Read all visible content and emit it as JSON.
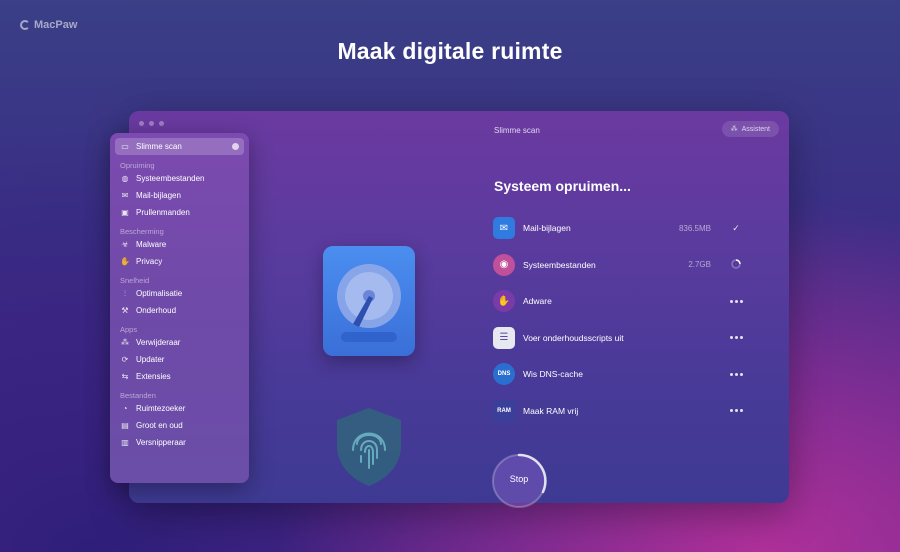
{
  "brand": {
    "name": "MacPaw"
  },
  "headline": "Maak digitale ruimte",
  "window": {
    "title": "Slimme scan",
    "assistant_label": "Assistent"
  },
  "sidebar": {
    "active": {
      "label": "Slimme scan",
      "icon": "monitor-icon"
    },
    "sections": [
      {
        "header": "Opruiming",
        "items": [
          {
            "label": "Systeembestanden",
            "icon": "fingerprint-icon"
          },
          {
            "label": "Mail-bijlagen",
            "icon": "mail-icon"
          },
          {
            "label": "Prullenmanden",
            "icon": "trash-icon"
          }
        ]
      },
      {
        "header": "Bescherming",
        "items": [
          {
            "label": "Malware",
            "icon": "biohazard-icon"
          },
          {
            "label": "Privacy",
            "icon": "hand-icon"
          }
        ]
      },
      {
        "header": "Snelheid",
        "items": [
          {
            "label": "Optimalisatie",
            "icon": "sliders-icon"
          },
          {
            "label": "Onderhoud",
            "icon": "wrench-icon"
          }
        ]
      },
      {
        "header": "Apps",
        "items": [
          {
            "label": "Verwijderaar",
            "icon": "uninstall-icon"
          },
          {
            "label": "Updater",
            "icon": "update-icon"
          },
          {
            "label": "Extensies",
            "icon": "extension-icon"
          }
        ]
      },
      {
        "header": "Bestanden",
        "items": [
          {
            "label": "Ruimtezoeker",
            "icon": "space-lens-icon"
          },
          {
            "label": "Groot en oud",
            "icon": "folder-icon"
          },
          {
            "label": "Versnipperaar",
            "icon": "shredder-icon"
          }
        ]
      }
    ]
  },
  "main": {
    "title": "Systeem opruimen...",
    "tasks": [
      {
        "label": "Mail-bijlagen",
        "size": "836.5MB",
        "status": "done",
        "icon": "mail-attachment-icon",
        "color": "#2f7be0"
      },
      {
        "label": "Systeembestanden",
        "size": "2.7GB",
        "status": "progress",
        "icon": "system-junk-icon",
        "color": "#c0509a"
      },
      {
        "label": "Adware",
        "size": "",
        "status": "pending",
        "icon": "adware-hand-icon",
        "color": "#7a3aa8"
      },
      {
        "label": "Voer onderhoudsscripts uit",
        "size": "",
        "status": "pending",
        "icon": "checklist-icon",
        "color": "#e8e8f0"
      },
      {
        "label": "Wis DNS-cache",
        "size": "",
        "status": "pending",
        "icon": "dns-icon",
        "color": "#2a6fd0"
      },
      {
        "label": "Maak RAM vrij",
        "size": "",
        "status": "pending",
        "icon": "ram-icon",
        "color": "#3a3f9a"
      }
    ],
    "stop_label": "Stop"
  },
  "colors": {
    "accent_blue": "#4b8ef0",
    "window_top": "#6b3aa1",
    "sidebar": "#7c4ab0"
  }
}
